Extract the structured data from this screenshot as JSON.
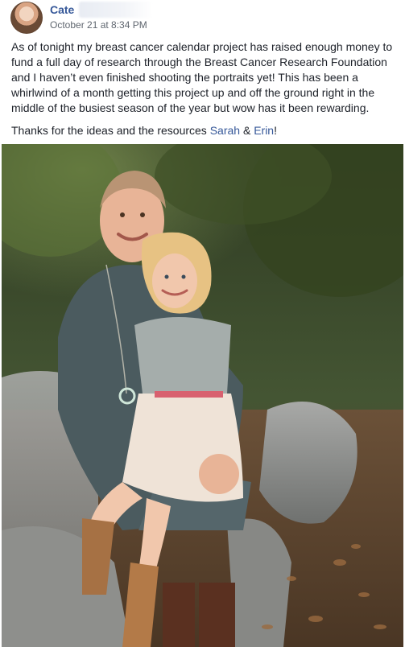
{
  "post": {
    "author": "Cate",
    "timestamp": "October 21 at 8:34 PM",
    "paragraph1": "As of tonight my breast cancer calendar project has raised enough money to fund a full day of research through the Breast Cancer Research Foundation and I haven’t even finished shooting the portraits yet! This has been a whirlwind of a month getting this project up and off the ground right in the middle of the busiest season of the year but wow has it been rewarding.",
    "thanks_prefix": "Thanks for the ideas and the resources ",
    "mention1": "Sarah",
    "conjunction": " & ",
    "mention2": "Erin",
    "thanks_suffix": "!"
  },
  "colors": {
    "link": "#365899",
    "secondary_text": "#606770",
    "body_text": "#1d2129"
  },
  "icons": {
    "avatar": "profile-photo"
  }
}
